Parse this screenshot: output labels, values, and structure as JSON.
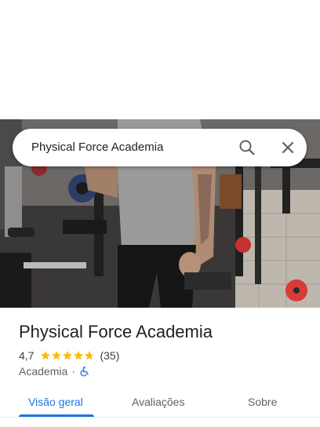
{
  "search": {
    "query": "Physical Force Academia"
  },
  "place": {
    "name": "Physical Force Academia",
    "rating": "4,7",
    "rating_value": 4.7,
    "review_count": "(35)",
    "category": "Academia",
    "separator": "·"
  },
  "tabs": [
    {
      "label": "Visão geral",
      "selected": true
    },
    {
      "label": "Avaliações",
      "selected": false
    },
    {
      "label": "Sobre",
      "selected": false
    }
  ],
  "colors": {
    "accent": "#1a73e8",
    "star": "#fbbc04",
    "accessibility": "#1a73e8"
  },
  "icons": {
    "search": "search-icon",
    "close": "close-icon",
    "accessible": "wheelchair-icon",
    "star": "star-icon"
  }
}
